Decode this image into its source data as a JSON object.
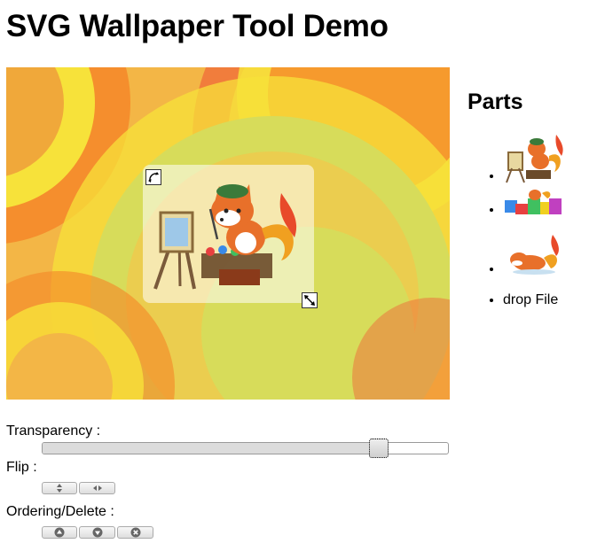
{
  "page": {
    "title": "SVG Wallpaper Tool Demo"
  },
  "canvas": {
    "colors": {
      "base": "#f3b646",
      "yellow": "#f7e23a",
      "green": "#d7dc5a",
      "orange": "#f58a2a",
      "red": "#f06a3a"
    },
    "handles": {
      "rotate_icon": "rotate-arrows-icon",
      "resize_icon": "resize-arrows-icon"
    }
  },
  "sidebar": {
    "title": "Parts",
    "items": [
      {
        "type": "image",
        "icon": "fox-painter-thumbnail"
      },
      {
        "type": "image",
        "icon": "gift-boxes-thumbnail"
      },
      {
        "type": "image",
        "icon": "sleeping-fox-thumbnail"
      },
      {
        "type": "text",
        "label": "drop File"
      }
    ]
  },
  "controls": {
    "transparency_label": "Transparency :",
    "transparency_value": 0.83,
    "flip_label": "Flip :",
    "flip_buttons": [
      {
        "icon": "flip-vertical-icon"
      },
      {
        "icon": "flip-horizontal-icon"
      }
    ],
    "ordering_label": "Ordering/Delete :",
    "ordering_buttons": [
      {
        "icon": "bring-forward-icon"
      },
      {
        "icon": "send-backward-icon"
      },
      {
        "icon": "delete-icon"
      }
    ]
  }
}
